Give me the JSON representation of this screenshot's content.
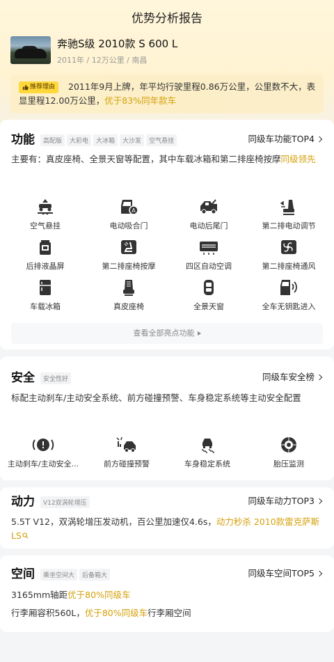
{
  "page": {
    "title": "优势分析报告"
  },
  "car": {
    "name": "奔驰S级 2010款 S 600 L",
    "meta": "2011年 / 12万公里 / 南昌"
  },
  "reason": {
    "tag": "推荐理由",
    "text": "2011年9月上牌，年平均行驶里程0.86万公里，公里数不大，表显里程12.00万公里，",
    "highlight": "优于83%同年款车"
  },
  "features": {
    "title": "功能",
    "chips": [
      "高配版",
      "大彩电",
      "大冰箱",
      "大沙发",
      "空气悬挂"
    ],
    "link": "同级车功能TOP4",
    "summary": "主要有：真皮座椅、全景天窗等配置，其中车载冰箱和第二排座椅按摩",
    "summary_highlight": "同级领先",
    "items": [
      {
        "label": "空气悬挂",
        "icon": "air-suspension-icon"
      },
      {
        "label": "电动吸合门",
        "icon": "soft-close-door-icon"
      },
      {
        "label": "电动后尾门",
        "icon": "power-tailgate-icon"
      },
      {
        "label": "第二排电动调节",
        "icon": "power-seat-adjust-icon"
      },
      {
        "label": "后排液晶屏",
        "icon": "rear-screen-icon"
      },
      {
        "label": "第二排座椅按摩",
        "icon": "seat-massage-icon"
      },
      {
        "label": "四区自动空调",
        "icon": "climate-control-icon"
      },
      {
        "label": "第二排座椅通风",
        "icon": "seat-ventilation-icon"
      },
      {
        "label": "车载冰箱",
        "icon": "car-fridge-icon"
      },
      {
        "label": "真皮座椅",
        "icon": "leather-seat-icon"
      },
      {
        "label": "全景天窗",
        "icon": "panoramic-sunroof-icon"
      },
      {
        "label": "全车无钥匙进入",
        "icon": "keyless-entry-icon"
      }
    ],
    "view_all": "查看全部亮点功能"
  },
  "safety": {
    "title": "安全",
    "chips": [
      "安全性好"
    ],
    "link": "同级车安全榜",
    "summary": "标配主动刹车/主动安全系统、前方碰撞预警、车身稳定系统等主动安全配置",
    "items": [
      {
        "label": "主动刹车/主动安全...",
        "icon": "active-brake-icon"
      },
      {
        "label": "前方碰撞预警",
        "icon": "collision-warning-icon"
      },
      {
        "label": "车身稳定系统",
        "icon": "stability-control-icon"
      },
      {
        "label": "胎压监测",
        "icon": "tire-pressure-icon"
      }
    ]
  },
  "power": {
    "title": "动力",
    "chips": [
      "V12双涡轮增压"
    ],
    "link": "同级车动力TOP3",
    "summary": "5.5T V12，双涡轮增压发动机，百公里加速仅4.6s，",
    "summary_highlight": "动力秒杀 2010款雷克萨斯LS"
  },
  "space": {
    "title": "空间",
    "chips": [
      "乘坐空间大",
      "后备箱大"
    ],
    "link": "同级车空间TOP5",
    "line1": "3165mm轴距",
    "line1_highlight": "优于80%同级车",
    "line2": "行李厢容积560L，",
    "line2_highlight": "优于80%同级车",
    "line2_tail": "行李厢空间"
  },
  "colors": {
    "accent": "#d4a00a",
    "tag_bg": "#ffd83b",
    "icon": "#333333"
  }
}
